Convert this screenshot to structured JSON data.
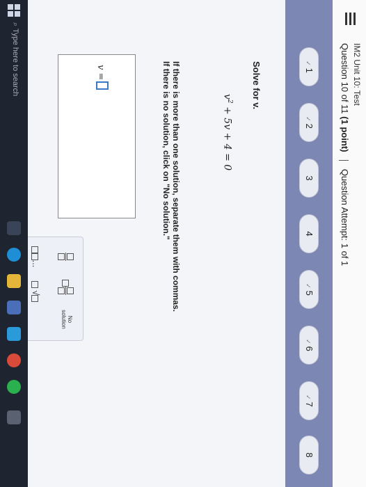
{
  "header": {
    "course_title": "IM2 Unit 10: Test",
    "question_of": "Question 10 of 11",
    "points": "(1 point)",
    "attempt": "Question Attempt: 1 of 1"
  },
  "nav": {
    "questions": [
      {
        "label": "1",
        "checked": true
      },
      {
        "label": "2",
        "checked": true
      },
      {
        "label": "3",
        "checked": false
      },
      {
        "label": "4",
        "checked": false
      },
      {
        "label": "5",
        "checked": true
      },
      {
        "label": "6",
        "checked": true
      },
      {
        "label": "7",
        "checked": true
      },
      {
        "label": "8",
        "checked": false
      }
    ],
    "check_mark": "✓"
  },
  "problem": {
    "prompt": "Solve for v.",
    "equation_lhs": "v",
    "equation_exp": "2",
    "equation_rest": " + 5v + 4 = 0",
    "instruction_line1": "If there is more than one solution, separate them with commas.",
    "instruction_line2": "If there is no solution, click on \"No solution.\"",
    "answer_label": "v ="
  },
  "keypad": {
    "no_solution": "No solution",
    "comma_dots": "...",
    "times": "×",
    "undo": "↺",
    "help": "?"
  },
  "taskbar": {
    "search_placeholder": "Type here to search"
  }
}
